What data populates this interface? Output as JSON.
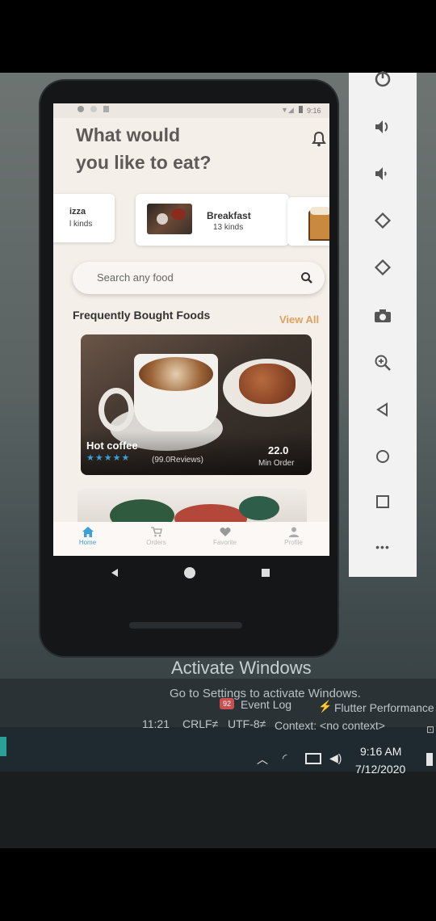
{
  "app": {
    "status_time": "9:16",
    "title_line1": "What would",
    "title_line2": "you like to eat?",
    "categories": [
      {
        "name": "izza",
        "kinds": "l kinds"
      },
      {
        "name": "Breakfast",
        "kinds": "13 kinds"
      }
    ],
    "search_placeholder": "Search any food",
    "section_title": "Frequently Bought Foods",
    "view_all": "View All",
    "featured": {
      "name": "Hot coffee",
      "rating": 5,
      "stars": "★★★★★",
      "reviews": "(99.0Reviews)",
      "price": "22.0",
      "price_caption": "Min Order"
    },
    "bottom_nav": [
      "Home",
      "Orders",
      "Favorite",
      "Profile"
    ],
    "accent": "#e0a060",
    "active_color": "#3aa0d8"
  },
  "side_panel": {
    "icons": [
      "power-icon",
      "volume-up-icon",
      "volume-down-icon",
      "rotate-left-icon",
      "rotate-right-icon",
      "camera-icon",
      "zoom-in-icon",
      "back-icon",
      "home-icon",
      "overview-icon",
      "more-icon"
    ]
  },
  "desktop": {
    "watermark_line1": "Activate Windows",
    "watermark_line2": "Go to Settings to activate Windows.",
    "event_log": "Event Log",
    "event_log_badge": "92",
    "flutter_perf": "Flutter Performance",
    "status_position": "11:21",
    "status_crlf": "CRLF≠",
    "status_encoding": "UTF-8≠",
    "status_context": "Context: <no context>",
    "clock_time": "9:16 AM",
    "clock_date": "7/12/2020"
  }
}
